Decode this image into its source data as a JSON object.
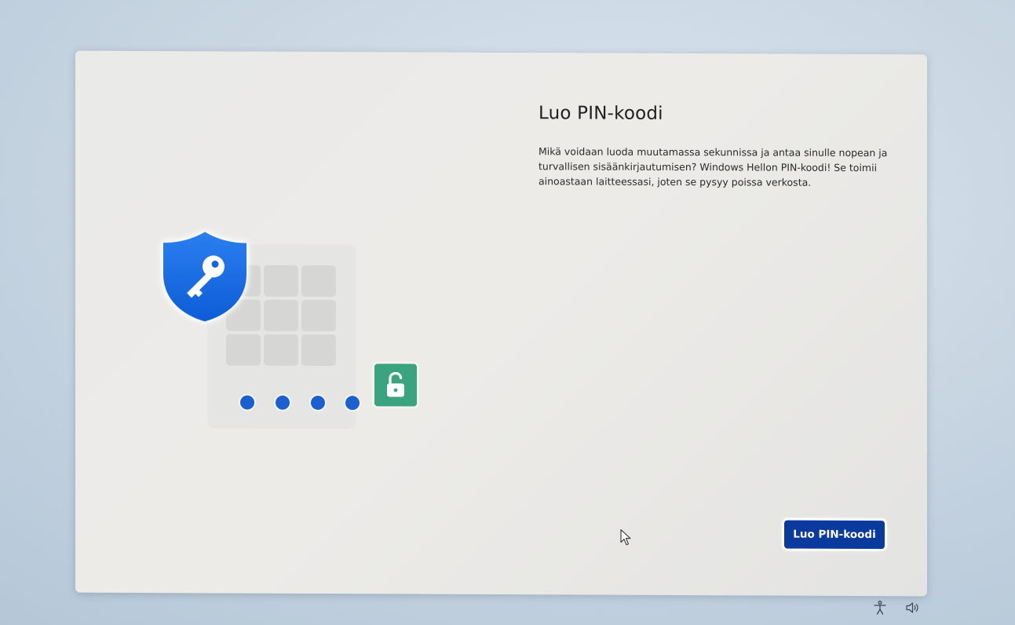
{
  "page": {
    "title": "Luo PIN-koodi",
    "description": "Mikä voidaan luoda muutamassa sekunnissa ja antaa sinulle nopean ja turvallisen sisäänkirjautumisen? Windows Hellon PIN-koodi! Se toimii ainoastaan laitteessasi, joten se pysyy poissa verkosta."
  },
  "actions": {
    "create_pin_label": "Luo PIN-koodi"
  },
  "illustration": {
    "shield_icon": "shield-key-icon",
    "unlock_icon": "unlock-icon",
    "pin_dots_count": 4,
    "keypad_keys_count": 9
  },
  "system_tray": {
    "accessibility_icon": "accessibility-icon",
    "volume_icon": "volume-icon"
  },
  "colors": {
    "accent": "#0a3a9e",
    "shield_blue": "#1a73e8",
    "pin_dot": "#1c5fd0",
    "unlock_green": "#3aa37f"
  }
}
